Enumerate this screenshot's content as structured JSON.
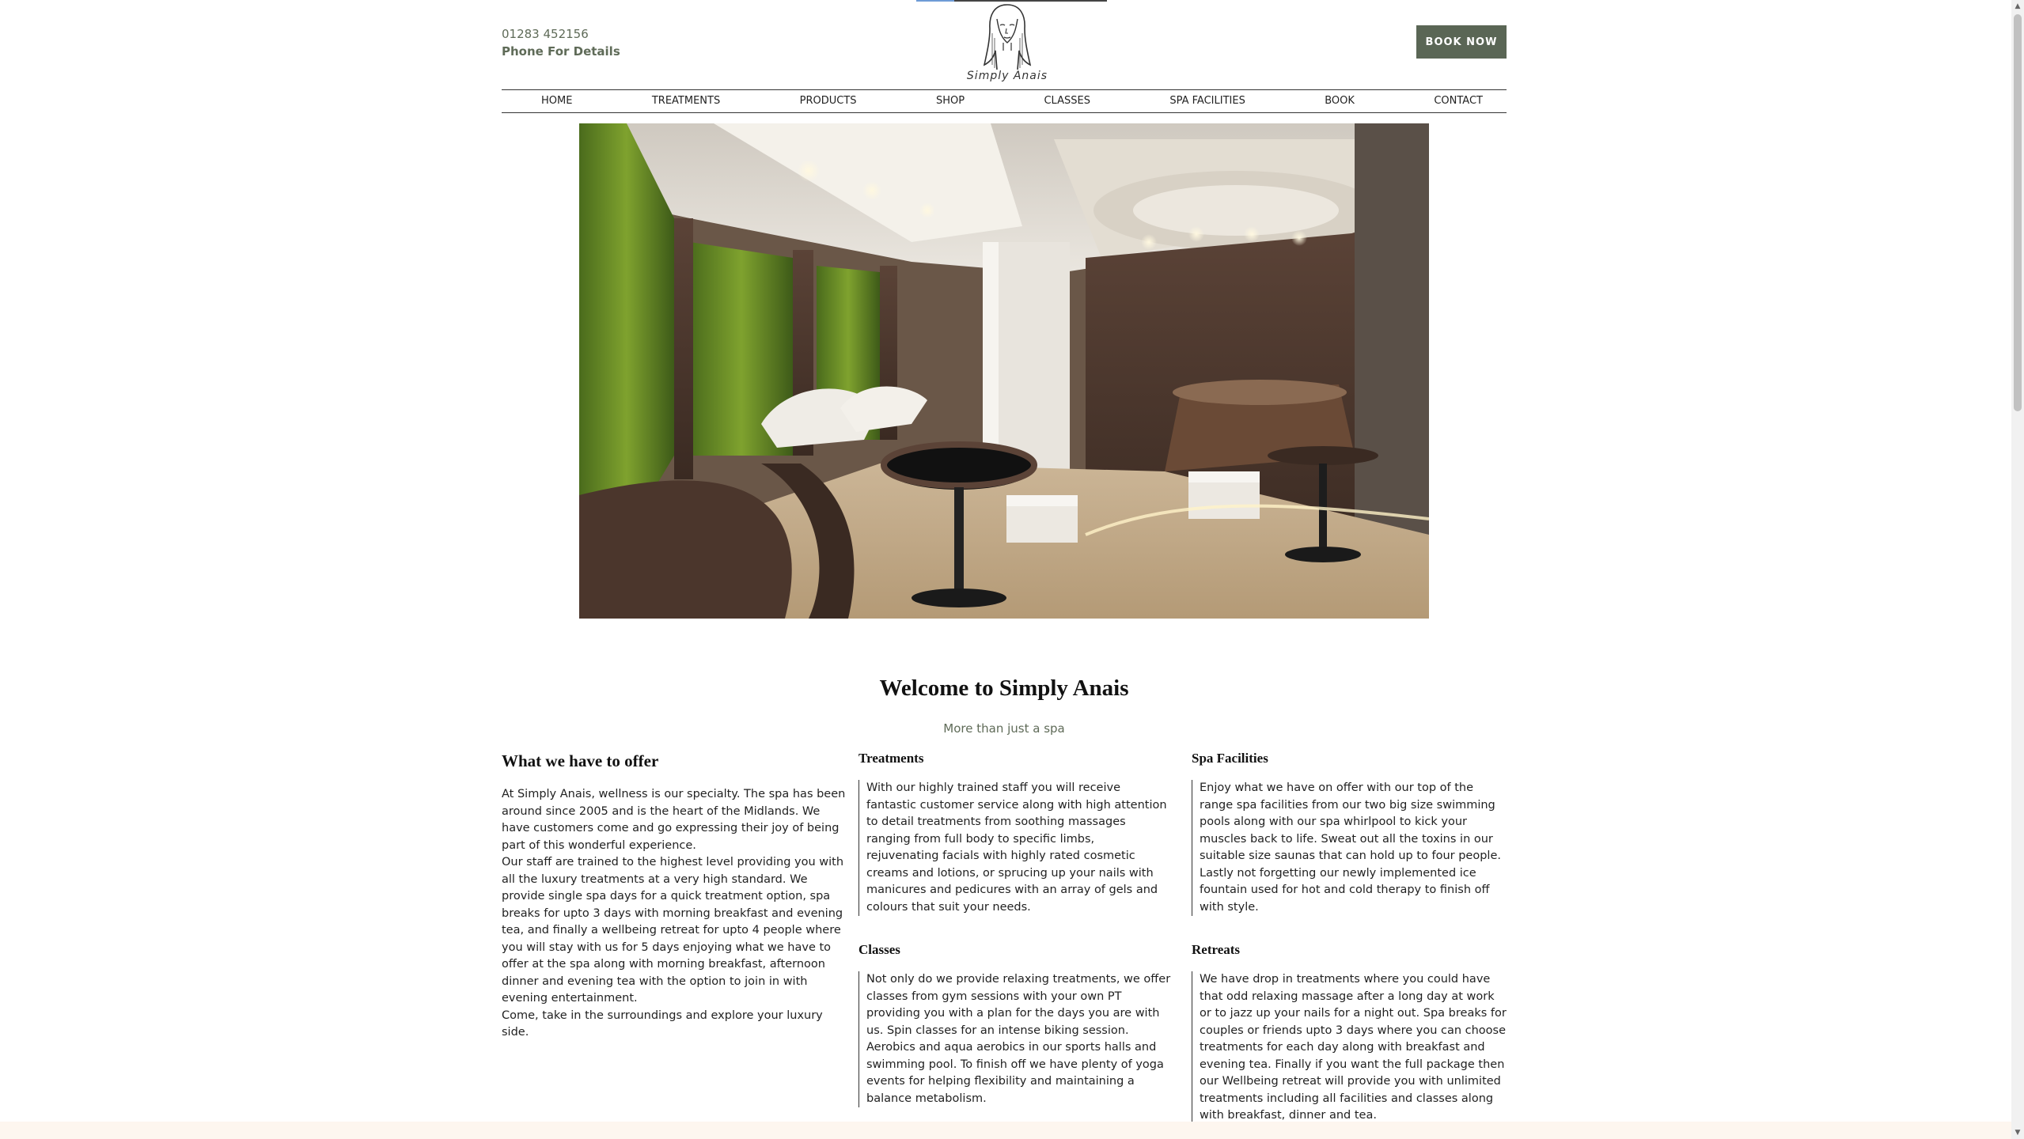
{
  "header": {
    "phone_number": "01283 452156",
    "phone_note": "Phone For Details",
    "brand_name": "Simply Anais",
    "book_button": "BOOK NOW"
  },
  "nav": {
    "items": [
      "HOME",
      "TREATMENTS",
      "PRODUCTS",
      "SHOP",
      "CLASSES",
      "SPA FACILITIES",
      "BOOK",
      "CONTACT"
    ]
  },
  "welcome": {
    "title": "Welcome to Simply Anais",
    "subtitle": "More than just a spa"
  },
  "offer": {
    "title": "What we have to offer",
    "paragraphs": [
      "At Simply Anais, wellness is our specialty. The spa has been around since 2005 and is the heart of the Midlands. We have customers come and go expressing their joy of being part of this wonderful experience.",
      "Our staff are trained to the highest level providing you with all the luxury treatments at a very high standard. We provide single spa days for a quick treatment option, spa breaks for upto 3 days with morning breakfast and evening tea, and finally a wellbeing retreat for upto 4 people where you will stay with us for 5 days enjoying what we have to offer at the spa along with morning breakfast, afternoon dinner and evening tea with the option to join in with evening entertainment.",
      "Come, take in the surroundings and explore your luxury side."
    ]
  },
  "sections": {
    "treatments": {
      "title": "Treatments",
      "body": "With our highly trained staff you will receive fantastic customer service along with high attention to detail treatments from soothing massages ranging from full body to specific limbs, rejuvenating facials with highly rated cosmetic creams and lotions, or sprucing up your nails with manicures and pedicures with an array of gels and colours that suit your needs."
    },
    "spa_facilities": {
      "title": "Spa Facilities",
      "body": "Enjoy what we have on offer with our top of the range spa facilities from our two big size swimming pools along with our spa whirlpool to kick your muscles back to life. Sweat out all the toxins in our suitable size saunas that can hold up to four people. Lastly not forgetting our newly implemented ice fountain used for hot and cold therapy to finish off with style."
    },
    "classes": {
      "title": "Classes",
      "body": "Not only do we provide relaxing treatments, we offer classes from gym sessions with your own PT providing you with a plan for the days you are with us. Spin classes for an intense biking session. Aerobics and aqua aerobics in our sports halls and swimming pool. To finish off we have plenty of yoga events for helping flexibility and maintaining a balance metabolism."
    },
    "retreats": {
      "title": "Retreats",
      "body": "We have drop in treatments where you could have that odd relaxing massage after a long day at work or to jazz up your nails for a night out. Spa breaks for couples or friends upto 3 days where you can choose treatments for each day along with breakfast and evening tea. Finally if you want the full package then our Wellbeing retreat will provide you with unlimited treatments including all facilities and classes along with breakfast, dinner and tea."
    }
  },
  "colors": {
    "accent": "#5a6655",
    "text_muted": "#5f6b58",
    "footer_strip": "#fdf6ef"
  },
  "icons": {
    "logo": "woman-face-logo",
    "scroll_up": "triangle-up-icon",
    "scroll_down": "triangle-down-icon"
  }
}
